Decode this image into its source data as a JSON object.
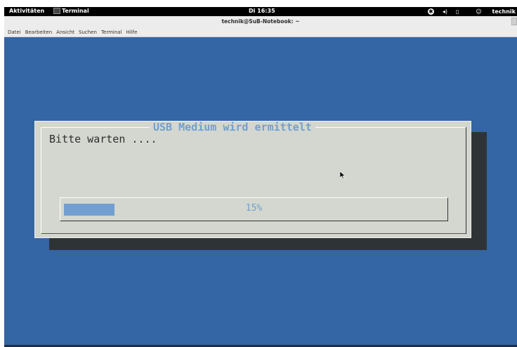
{
  "topbar": {
    "activities": "Aktivitäten",
    "app_name": "Terminal",
    "clock": "Di 16:35",
    "user": "technik"
  },
  "window": {
    "title": "technik@SuB-Notebook: ~"
  },
  "menu": {
    "items": [
      "Datei",
      "Bearbeiten",
      "Ansicht",
      "Suchen",
      "Terminal",
      "Hilfe"
    ]
  },
  "dialog": {
    "title": "USB Medium wird ermittelt",
    "message": "Bitte warten ....",
    "progress_percent": 15,
    "progress_label": "15%"
  },
  "colors": {
    "terminal_bg": "#3465a5",
    "dialog_bg": "#d3d7cf",
    "accent": "#729fcf",
    "shadow": "#2e3436"
  },
  "icons": {
    "tray": [
      "accessibility-icon",
      "volume-icon",
      "battery-icon",
      "user-icon"
    ]
  }
}
